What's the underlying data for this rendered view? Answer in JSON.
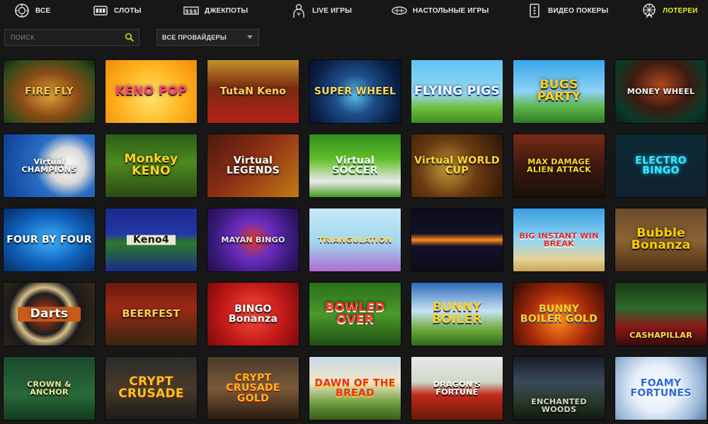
{
  "nav": {
    "items": [
      {
        "label": "ВСЕ",
        "icon": "casino-chip-icon",
        "active": false
      },
      {
        "label": "СЛОТЫ",
        "icon": "slot-machine-icon",
        "active": false
      },
      {
        "label": "ДЖЕКПОТЫ",
        "icon": "jackpot-777-icon",
        "active": false
      },
      {
        "label": "LIVE ИГРЫ",
        "icon": "live-dealer-icon",
        "active": false
      },
      {
        "label": "НАСТОЛЬНЫЕ ИГРЫ",
        "icon": "table-games-icon",
        "active": false
      },
      {
        "label": "ВИДЕО ПОКЕРЫ",
        "icon": "playing-card-icon",
        "active": false
      },
      {
        "label": "ЛОТЕРЕИ",
        "icon": "ferris-wheel-icon",
        "active": true
      }
    ]
  },
  "filters": {
    "search_placeholder": "ПОИСК",
    "provider_selected": "ВСЕ ПРОВАЙДЕРЫ"
  },
  "games": [
    {
      "title": "FIRE FLY"
    },
    {
      "title": "KENO POP"
    },
    {
      "title": "TutaN Keno"
    },
    {
      "title": "SUPER WHEEL"
    },
    {
      "title": "FLYING PIGS"
    },
    {
      "title": "BUGS PARTY"
    },
    {
      "title": "MONEY WHEEL"
    },
    {
      "title": "Virtual CHAMPIONS"
    },
    {
      "title": "Monkey KENO"
    },
    {
      "title": "Virtual LEGENDS"
    },
    {
      "title": "Virtual SOCCER"
    },
    {
      "title": "Virtual WORLD CUP"
    },
    {
      "title": "MAX DAMAGE ALIEN ATTACK"
    },
    {
      "title": "ELECTRO BINGO"
    },
    {
      "title": "FOUR BY FOUR"
    },
    {
      "title": "Keno4"
    },
    {
      "title": "MAYAN BINGO"
    },
    {
      "title": "TRIANGULATION"
    },
    {
      "title": ""
    },
    {
      "title": "BIG INSTANT WIN BREAK"
    },
    {
      "title": "Bubble Bonanza"
    },
    {
      "title": "Darts"
    },
    {
      "title": "BEERFEST"
    },
    {
      "title": "BINGO Bonanza"
    },
    {
      "title": "BOWLED OVER"
    },
    {
      "title": "BUNNY BOILER"
    },
    {
      "title": "BUNNY BOILER GOLD"
    },
    {
      "title": "CASHAPILLAR"
    },
    {
      "title": "CROWN & ANCHOR"
    },
    {
      "title": "CRYPT CRUSADE"
    },
    {
      "title": "CRYPT CRUSADE GOLD"
    },
    {
      "title": "DAWN OF THE BREAD"
    },
    {
      "title": "DRAGON'S FORTUNE"
    },
    {
      "title": "ENCHANTED WOODS"
    },
    {
      "title": "FOAMY FORTUNES"
    }
  ],
  "colors": {
    "background": "#171717",
    "nav_text": "#e6e6e6",
    "nav_active": "#e8ef2a",
    "search_icon": "#c8d219"
  }
}
